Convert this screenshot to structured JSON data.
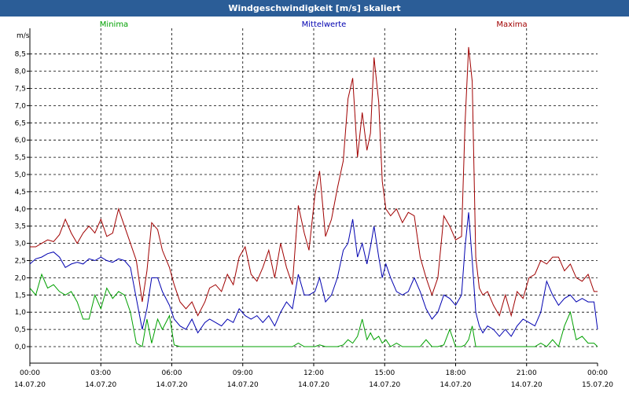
{
  "window": {
    "title": "Windgeschwindigkeit [m/s] skaliert"
  },
  "chart_data": {
    "type": "line",
    "title": "Windgeschwindigkeit [m/s] skaliert",
    "ylabel": "m/s",
    "ylim": [
      -0.4,
      9.1
    ],
    "yticks": [
      "0,0",
      "0,5",
      "1,0",
      "1,5",
      "2,0",
      "2,5",
      "3,0",
      "3,5",
      "4,0",
      "4,5",
      "5,0",
      "5,5",
      "6,0",
      "6,5",
      "7,0",
      "7,5",
      "8,0",
      "8,5"
    ],
    "xlim": [
      0,
      24
    ],
    "xticks": [
      {
        "time": "00:00",
        "date": "14.07.20"
      },
      {
        "time": "03:00",
        "date": "14.07.20"
      },
      {
        "time": "06:00",
        "date": "14.07.20"
      },
      {
        "time": "09:00",
        "date": "14.07.20"
      },
      {
        "time": "12:00",
        "date": "14.07.20"
      },
      {
        "time": "15:00",
        "date": "14.07.20"
      },
      {
        "time": "18:00",
        "date": "14.07.20"
      },
      {
        "time": "21:00",
        "date": "14.07.20"
      },
      {
        "time": "00:00",
        "date": "15.07.20"
      }
    ],
    "grid": true,
    "legend_position": "top",
    "series": [
      {
        "name": "Maxima",
        "color": "#a00000",
        "x": [
          0,
          0.25,
          0.5,
          0.75,
          1,
          1.25,
          1.5,
          1.75,
          2,
          2.25,
          2.5,
          2.75,
          3,
          3.25,
          3.5,
          3.75,
          4,
          4.25,
          4.5,
          4.75,
          4.95,
          5.15,
          5.4,
          5.6,
          5.9,
          6.1,
          6.35,
          6.6,
          6.85,
          7.1,
          7.4,
          7.6,
          7.85,
          8.1,
          8.35,
          8.6,
          8.85,
          9.1,
          9.35,
          9.6,
          9.85,
          10.1,
          10.35,
          10.6,
          10.85,
          11.1,
          11.35,
          11.6,
          11.8,
          12.05,
          12.25,
          12.5,
          12.75,
          13,
          13.25,
          13.45,
          13.65,
          13.85,
          14.05,
          14.25,
          14.4,
          14.55,
          14.75,
          14.9,
          15.05,
          15.25,
          15.5,
          15.75,
          16,
          16.25,
          16.5,
          16.75,
          17,
          17.25,
          17.5,
          17.75,
          18,
          18.25,
          18.4,
          18.55,
          18.7,
          18.85,
          19,
          19.15,
          19.35,
          19.6,
          19.85,
          20.1,
          20.35,
          20.6,
          20.85,
          21.1,
          21.35,
          21.6,
          21.85,
          22.1,
          22.35,
          22.6,
          22.85,
          23.1,
          23.35,
          23.6,
          23.85,
          24
        ],
        "values": [
          2.9,
          2.9,
          3.0,
          3.1,
          3.05,
          3.25,
          3.7,
          3.3,
          3.0,
          3.3,
          3.5,
          3.3,
          3.7,
          3.2,
          3.3,
          4.0,
          3.5,
          3.0,
          2.5,
          1.3,
          2.2,
          3.6,
          3.4,
          2.8,
          2.3,
          1.8,
          1.3,
          1.1,
          1.3,
          0.9,
          1.3,
          1.7,
          1.8,
          1.6,
          2.1,
          1.8,
          2.6,
          2.9,
          2.1,
          1.9,
          2.3,
          2.8,
          2.0,
          3.0,
          2.3,
          1.8,
          4.1,
          3.3,
          2.8,
          4.4,
          5.1,
          3.2,
          3.7,
          4.6,
          5.4,
          7.2,
          7.8,
          5.5,
          6.8,
          5.7,
          6.2,
          8.4,
          7.1,
          4.8,
          4.0,
          3.8,
          4.0,
          3.6,
          3.9,
          3.8,
          2.6,
          2.0,
          1.5,
          2.0,
          3.8,
          3.5,
          3.1,
          3.2,
          6.5,
          8.7,
          7.7,
          2.6,
          1.7,
          1.5,
          1.6,
          1.2,
          0.9,
          1.5,
          0.9,
          1.6,
          1.4,
          2.0,
          2.1,
          2.5,
          2.4,
          2.6,
          2.6,
          2.2,
          2.4,
          2.0,
          1.9,
          2.1,
          1.6,
          1.6
        ],
        "label_position": "top-right"
      },
      {
        "name": "Mittelwerte",
        "color": "#0000b0",
        "x": [
          0,
          0.25,
          0.5,
          0.75,
          1,
          1.25,
          1.5,
          1.75,
          2,
          2.25,
          2.5,
          2.75,
          3,
          3.25,
          3.5,
          3.75,
          4,
          4.25,
          4.5,
          4.75,
          4.95,
          5.15,
          5.4,
          5.6,
          5.9,
          6.1,
          6.35,
          6.6,
          6.85,
          7.1,
          7.4,
          7.6,
          7.85,
          8.1,
          8.35,
          8.6,
          8.85,
          9.1,
          9.35,
          9.6,
          9.85,
          10.1,
          10.35,
          10.6,
          10.85,
          11.1,
          11.35,
          11.6,
          11.8,
          12.05,
          12.25,
          12.5,
          12.75,
          13,
          13.25,
          13.45,
          13.65,
          13.85,
          14.05,
          14.25,
          14.4,
          14.55,
          14.75,
          14.9,
          15.05,
          15.25,
          15.5,
          15.75,
          16,
          16.25,
          16.5,
          16.75,
          17,
          17.25,
          17.5,
          17.75,
          18,
          18.25,
          18.4,
          18.55,
          18.7,
          18.85,
          19,
          19.15,
          19.35,
          19.6,
          19.85,
          20.1,
          20.35,
          20.6,
          20.85,
          21.1,
          21.35,
          21.6,
          21.85,
          22.1,
          22.35,
          22.6,
          22.85,
          23.1,
          23.35,
          23.6,
          23.85,
          24
        ],
        "values": [
          2.4,
          2.55,
          2.6,
          2.7,
          2.75,
          2.6,
          2.3,
          2.4,
          2.45,
          2.4,
          2.55,
          2.5,
          2.6,
          2.5,
          2.45,
          2.55,
          2.5,
          2.3,
          1.4,
          0.5,
          1.1,
          2.0,
          2.0,
          1.6,
          1.2,
          0.8,
          0.6,
          0.5,
          0.8,
          0.4,
          0.7,
          0.8,
          0.7,
          0.6,
          0.8,
          0.7,
          1.1,
          0.9,
          0.8,
          0.9,
          0.7,
          0.9,
          0.6,
          1.0,
          1.3,
          1.1,
          2.1,
          1.5,
          1.5,
          1.6,
          2.0,
          1.3,
          1.5,
          2.0,
          2.8,
          3.0,
          3.7,
          2.6,
          3.0,
          2.4,
          2.9,
          3.5,
          2.6,
          2.0,
          2.4,
          2.0,
          1.6,
          1.5,
          1.6,
          2.0,
          1.6,
          1.1,
          0.8,
          1.0,
          1.5,
          1.4,
          1.2,
          1.5,
          2.9,
          3.9,
          2.5,
          1.0,
          0.6,
          0.4,
          0.6,
          0.5,
          0.3,
          0.5,
          0.3,
          0.6,
          0.8,
          0.7,
          0.6,
          1.0,
          1.9,
          1.5,
          1.2,
          1.4,
          1.5,
          1.3,
          1.4,
          1.3,
          1.3,
          0.5
        ],
        "label_position": "top-center"
      },
      {
        "name": "Minima",
        "color": "#00a000",
        "x": [
          0,
          0.25,
          0.5,
          0.75,
          1,
          1.25,
          1.5,
          1.75,
          2,
          2.25,
          2.5,
          2.75,
          3,
          3.25,
          3.5,
          3.75,
          4,
          4.25,
          4.5,
          4.75,
          4.95,
          5.15,
          5.4,
          5.6,
          5.9,
          6.1,
          6.35,
          6.6,
          6.85,
          7.1,
          7.4,
          7.6,
          7.85,
          8.1,
          8.35,
          8.6,
          8.85,
          9.1,
          9.35,
          9.6,
          9.85,
          10.1,
          10.35,
          10.6,
          10.85,
          11.1,
          11.35,
          11.6,
          11.8,
          12.05,
          12.25,
          12.5,
          12.75,
          13,
          13.25,
          13.45,
          13.65,
          13.85,
          14.05,
          14.25,
          14.4,
          14.55,
          14.75,
          14.9,
          15.05,
          15.25,
          15.5,
          15.75,
          16,
          16.25,
          16.5,
          16.75,
          17,
          17.25,
          17.5,
          17.75,
          18,
          18.25,
          18.4,
          18.55,
          18.7,
          18.85,
          19,
          19.15,
          19.35,
          19.6,
          19.85,
          20.1,
          20.35,
          20.6,
          20.85,
          21.1,
          21.35,
          21.6,
          21.85,
          22.1,
          22.35,
          22.6,
          22.85,
          23.1,
          23.35,
          23.6,
          23.85,
          24
        ],
        "values": [
          1.7,
          1.5,
          2.1,
          1.7,
          1.8,
          1.6,
          1.5,
          1.6,
          1.3,
          0.8,
          0.8,
          1.5,
          1.1,
          1.7,
          1.4,
          1.6,
          1.5,
          1.0,
          0.1,
          0.0,
          0.8,
          0.1,
          0.8,
          0.5,
          0.9,
          0.05,
          0.0,
          0.0,
          0.0,
          0.0,
          0.0,
          0.0,
          0.0,
          0.0,
          0.0,
          0.0,
          0.0,
          0.0,
          0.0,
          0.0,
          0.0,
          0.0,
          0.0,
          0.0,
          0.0,
          0.0,
          0.1,
          0.0,
          0.0,
          0.0,
          0.05,
          0.0,
          0.0,
          0.0,
          0.05,
          0.2,
          0.1,
          0.3,
          0.8,
          0.2,
          0.4,
          0.2,
          0.3,
          0.1,
          0.2,
          0.0,
          0.1,
          0.0,
          0.0,
          0.0,
          0.0,
          0.2,
          0.0,
          0.0,
          0.05,
          0.5,
          0.0,
          0.0,
          0.05,
          0.2,
          0.6,
          0.0,
          0.0,
          0.0,
          0.0,
          0.0,
          0.0,
          0.0,
          0.0,
          0.0,
          0.0,
          0.0,
          0.0,
          0.1,
          0.0,
          0.2,
          0.0,
          0.6,
          1.0,
          0.2,
          0.3,
          0.1,
          0.1,
          0.0
        ],
        "label_position": "top-left"
      }
    ]
  }
}
